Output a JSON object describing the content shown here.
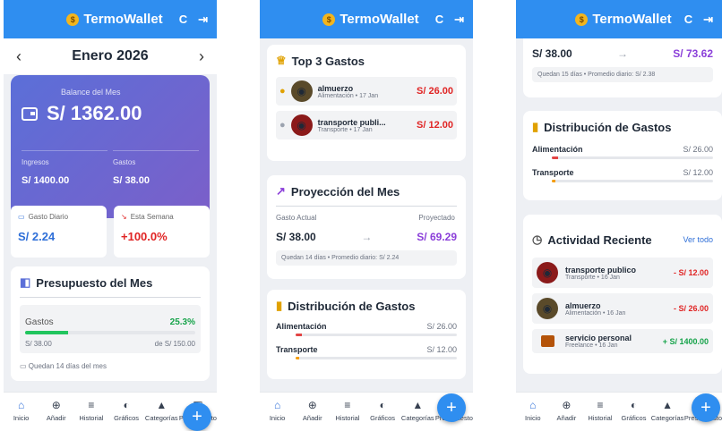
{
  "brand": "TermoWallet",
  "coin": "$",
  "icons": {
    "refresh": "C",
    "logout": "⇥"
  },
  "screen1": {
    "month": "Enero 2026",
    "balance_label": "Balance del Mes",
    "balance": "S/ 1362.00",
    "ingresos_label": "Ingresos",
    "ingresos": "S/ 1400.00",
    "gastos_label": "Gastos",
    "gastos": "S/ 38.00",
    "diario_label": "Gasto Diario",
    "diario": "S/ 2.24",
    "semana_label": "Esta Semana",
    "semana": "+100.0%",
    "presupuesto_title": "Presupuesto del Mes",
    "pres_gastos_label": "Gastos",
    "pres_pct": "25.3%",
    "pres_progress": 0.253,
    "pres_spent": "S/ 38.00",
    "pres_total": "de S/ 150.00",
    "pres_days": "Quedan 14 días del mes"
  },
  "screen2": {
    "top_title": "Top 3 Gastos",
    "top": [
      {
        "name": "almuerzo",
        "meta": "Alimentación • 17 Jan",
        "amount": "S/ 26.00"
      },
      {
        "name": "transporte publi...",
        "meta": "Transporte • 17 Jan",
        "amount": "S/ 12.00"
      }
    ],
    "proj_title": "Proyección del Mes",
    "actual_label": "Gasto Actual",
    "actual": "S/ 38.00",
    "proj_label": "Proyectado",
    "proj": "S/ 69.29",
    "proj_note": "Quedan 14 días • Promedio diario: S/ 2.24",
    "dist_title": "Distribución de Gastos",
    "dist": [
      {
        "name": "Alimentación",
        "amount": "S/ 26.00"
      },
      {
        "name": "Transporte",
        "amount": "S/ 12.00"
      }
    ]
  },
  "screen3": {
    "actual": "S/ 38.00",
    "proj": "S/ 73.62",
    "proj_note": "Quedan 15 días • Promedio diario: S/ 2.38",
    "dist_title": "Distribución de Gastos",
    "dist": [
      {
        "name": "Alimentación",
        "amount": "S/ 26.00"
      },
      {
        "name": "Transporte",
        "amount": "S/ 12.00"
      }
    ],
    "act_title": "Actividad Reciente",
    "ver_todo": "Ver todo",
    "acts": [
      {
        "name": "transporte publico",
        "meta": "Transporte • 16 Jan",
        "amount": "- S/ 12.00"
      },
      {
        "name": "almuerzo",
        "meta": "Alimentación • 16 Jan",
        "amount": "- S/ 26.00"
      },
      {
        "name": "servicio personal",
        "meta": "Freelance • 16 Jan",
        "amount": "+ S/ 1400.00"
      }
    ]
  },
  "nav": {
    "inicio": "Inicio",
    "anadir": "Añadir",
    "historial": "Historial",
    "graficos": "Gráficos",
    "categorias": "Categorías",
    "presupuesto": "Presupuesto",
    "fab": "+"
  }
}
